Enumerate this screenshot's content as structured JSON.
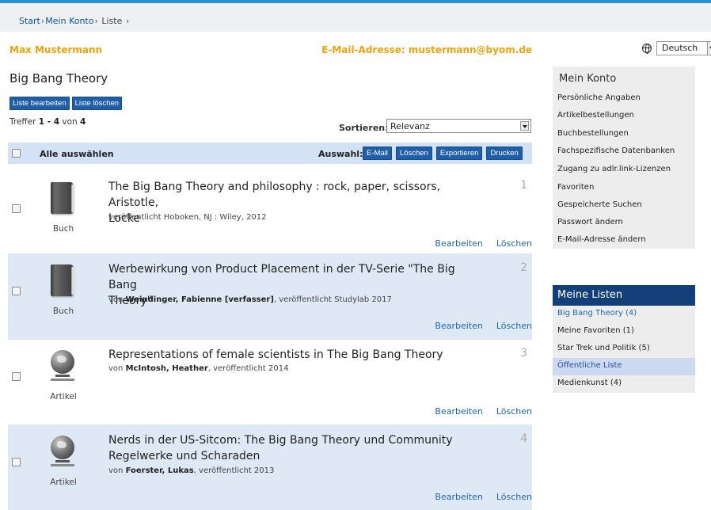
{
  "breadcrumb": {
    "items": [
      "Start",
      "Mein Konto",
      "Liste"
    ],
    "separator": "›"
  },
  "user": {
    "name": "Max Mustermann",
    "email_label": "E-Mail-Adresse: mustermann@byom.de"
  },
  "language": {
    "selected": "Deutsch",
    "icon": "globe-icon"
  },
  "list": {
    "title": "Big Bang Theory",
    "edit_label": "Liste bearbeiten",
    "delete_label": "Liste löschen",
    "hits_prefix": "Treffer",
    "hits_range": "1 - 4",
    "hits_of": "von",
    "hits_total": "4"
  },
  "sort": {
    "label": "Sortieren:",
    "selected": "Relevanz"
  },
  "selection_bar": {
    "select_all": "Alle auswählen",
    "label": "Auswahl:",
    "buttons": [
      "E-Mail",
      "Löschen",
      "Exportieren",
      "Drucken"
    ]
  },
  "results": [
    {
      "number": "1",
      "title_l1": "The Big Bang Theory and philosophy : rock, paper, scissors, Aristotle,",
      "title_l2": "Locke",
      "meta_prefix": "",
      "author": "",
      "meta_suffix": "veröffentlicht Hoboken, NJ : Wiley, 2012",
      "type": "Buch",
      "icon": "book-icon",
      "edit": "Bearbeiten",
      "delete": "Löschen"
    },
    {
      "number": "2",
      "title_l1": "Werbewirkung von Product Placement in der TV-Serie \"The Big Bang",
      "title_l2": "Theory\"",
      "meta_prefix": "von",
      "author": "Weindinger, Fabienne [verfasser]",
      "meta_suffix": ", veröffentlicht Studylab 2017",
      "type": "Buch",
      "icon": "book-icon",
      "edit": "Bearbeiten",
      "delete": "Löschen"
    },
    {
      "number": "3",
      "title_l1": "Representations of female scientists in The Big Bang Theory",
      "title_l2": "",
      "meta_prefix": "von",
      "author": "McIntosh, Heather",
      "meta_suffix": ", veröffentlicht 2014",
      "type": "Artikel",
      "icon": "globe-icon",
      "edit": "Bearbeiten",
      "delete": "Löschen"
    },
    {
      "number": "4",
      "title_l1": "Nerds in der US-Sitcom: The Big Bang Theory und Community",
      "title_l2": "Regelwerke und Scharaden",
      "meta_prefix": "von",
      "author": "Foerster, Lukas",
      "meta_suffix": ", veröffentlicht 2013",
      "type": "Artikel",
      "icon": "globe-icon",
      "edit": "Bearbeiten",
      "delete": "Löschen"
    }
  ],
  "account_panel": {
    "title": "Mein Konto",
    "items": [
      "Persönliche Angaben",
      "Artikelbestellungen",
      "Buchbestellungen",
      "Fachspezifische Datenbanken",
      "Zugang zu adlr.link-Lizenzen",
      "Favoriten",
      "Gespeicherte Suchen",
      "Passwort ändern",
      "E-Mail-Adresse ändern"
    ]
  },
  "lists_panel": {
    "title": "Meine Listen",
    "items": [
      "Big Bang Theory (4)",
      "Meine Favoriten (1)",
      "Star Trek und Politik (5)",
      "Öffentliche Liste",
      "Medienkunst (4)"
    ]
  },
  "colors": {
    "accent_orange": "#f0a30a",
    "button_blue": "#1f5ea8",
    "link_blue": "#1e66b5",
    "panel_header": "#133f78",
    "alt_row": "#dfe9f6"
  }
}
